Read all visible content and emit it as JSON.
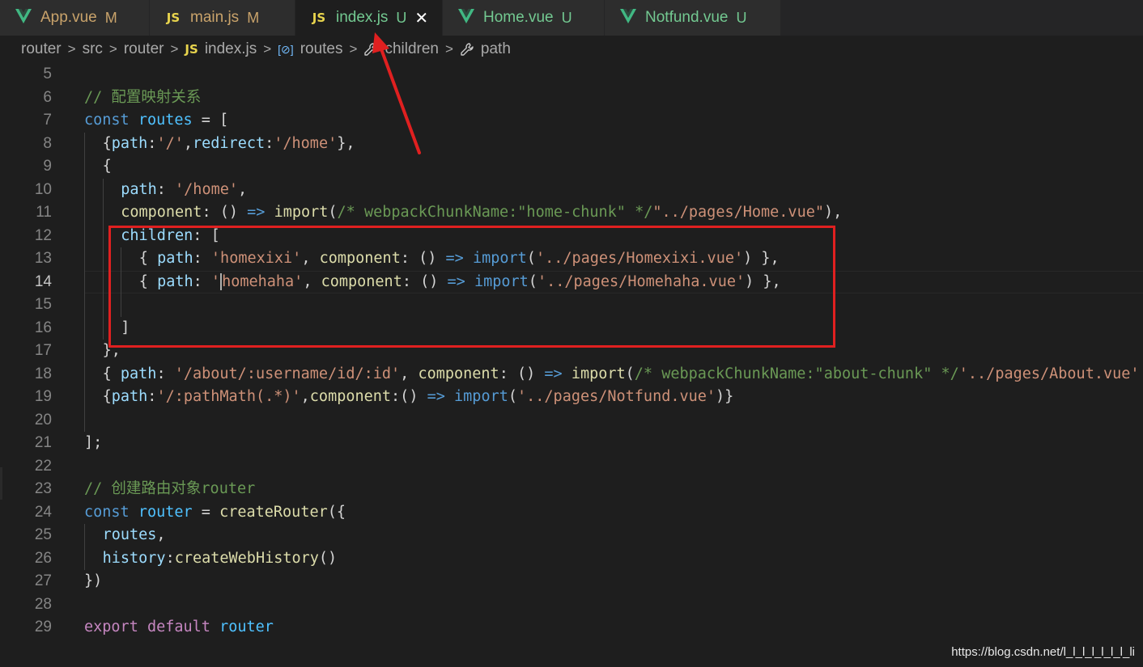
{
  "tabs": [
    {
      "icon": "vue-icon",
      "label": "App.vue",
      "status": "M",
      "status_type": "modified",
      "active": false
    },
    {
      "icon": "js-icon",
      "label": "main.js",
      "status": "M",
      "status_type": "modified",
      "active": false
    },
    {
      "icon": "js-icon",
      "label": "index.js",
      "status": "U",
      "status_type": "untracked",
      "active": true
    },
    {
      "icon": "vue-icon",
      "label": "Home.vue",
      "status": "U",
      "status_type": "untracked",
      "active": false
    },
    {
      "icon": "vue-icon",
      "label": "Notfund.vue",
      "status": "U",
      "status_type": "untracked",
      "active": false
    }
  ],
  "tab_icons": {
    "js": "JS",
    "close": "✕"
  },
  "breadcrumb": [
    {
      "label": "router",
      "icon": ""
    },
    {
      "label": "src",
      "icon": ""
    },
    {
      "label": "router",
      "icon": ""
    },
    {
      "label": "index.js",
      "icon": "js-icon"
    },
    {
      "label": "routes",
      "icon": "symbol-variable-icon"
    },
    {
      "label": "children",
      "icon": "wrench-icon"
    },
    {
      "label": "path",
      "icon": "wrench-icon"
    }
  ],
  "breadcrumb_symbol_glyph": "[⊘]",
  "editor": {
    "current_line": 14,
    "lines": [
      {
        "n": 5,
        "indent": 0,
        "tokens": []
      },
      {
        "n": 6,
        "indent": 0,
        "tokens": [
          [
            "cm",
            "// 配置映射关系"
          ]
        ]
      },
      {
        "n": 7,
        "indent": 0,
        "tokens": [
          [
            "kw",
            "const "
          ],
          [
            "var",
            "routes"
          ],
          [
            "pn",
            " = ["
          ]
        ]
      },
      {
        "n": 8,
        "indent": 1,
        "tokens": [
          [
            "pn",
            "{"
          ],
          [
            "prop",
            "path"
          ],
          [
            "pn",
            ":"
          ],
          [
            "str",
            "'/'"
          ],
          [
            "pn",
            ","
          ],
          [
            "prop",
            "redirect"
          ],
          [
            "pn",
            ":"
          ],
          [
            "str",
            "'/home'"
          ],
          [
            "pn",
            "},"
          ]
        ]
      },
      {
        "n": 9,
        "indent": 1,
        "tokens": [
          [
            "pn",
            "{"
          ]
        ]
      },
      {
        "n": 10,
        "indent": 2,
        "tokens": [
          [
            "prop",
            "path"
          ],
          [
            "pn",
            ": "
          ],
          [
            "str",
            "'/home'"
          ],
          [
            "pn",
            ","
          ]
        ]
      },
      {
        "n": 11,
        "indent": 2,
        "tokens": [
          [
            "fn",
            "component"
          ],
          [
            "pn",
            ": () "
          ],
          [
            "kw",
            "=>"
          ],
          [
            "pn",
            " "
          ],
          [
            "fn",
            "import"
          ],
          [
            "pn",
            "("
          ],
          [
            "cm",
            "/* webpackChunkName:\"home-chunk\" */"
          ],
          [
            "str",
            "\"../pages/Home.vue\""
          ],
          [
            "pn",
            "),"
          ]
        ]
      },
      {
        "n": 12,
        "indent": 2,
        "tokens": [
          [
            "prop",
            "children"
          ],
          [
            "pn",
            ": ["
          ]
        ]
      },
      {
        "n": 13,
        "indent": 3,
        "tokens": [
          [
            "pn",
            "{ "
          ],
          [
            "prop",
            "path"
          ],
          [
            "pn",
            ": "
          ],
          [
            "str",
            "'homexixi'"
          ],
          [
            "pn",
            ", "
          ],
          [
            "fn",
            "component"
          ],
          [
            "pn",
            ": () "
          ],
          [
            "kw",
            "=>"
          ],
          [
            "pn",
            " "
          ],
          [
            "kw",
            "import"
          ],
          [
            "pn",
            "("
          ],
          [
            "str",
            "'../pages/Homexixi.vue'"
          ],
          [
            "pn",
            ") },"
          ]
        ]
      },
      {
        "n": 14,
        "indent": 3,
        "tokens": [
          [
            "pn",
            "{ "
          ],
          [
            "prop",
            "path"
          ],
          [
            "pn",
            ": "
          ],
          [
            "str",
            "'"
          ],
          [
            "cursor",
            ""
          ],
          [
            "str",
            "homehaha'"
          ],
          [
            "pn",
            ", "
          ],
          [
            "fn",
            "component"
          ],
          [
            "pn",
            ": () "
          ],
          [
            "kw",
            "=>"
          ],
          [
            "pn",
            " "
          ],
          [
            "kw",
            "import"
          ],
          [
            "pn",
            "("
          ],
          [
            "str",
            "'../pages/Homehaha.vue'"
          ],
          [
            "pn",
            ") },"
          ]
        ]
      },
      {
        "n": 15,
        "indent": 3,
        "tokens": []
      },
      {
        "n": 16,
        "indent": 2,
        "tokens": [
          [
            "pn",
            "]"
          ]
        ]
      },
      {
        "n": 17,
        "indent": 1,
        "tokens": [
          [
            "pn",
            "},"
          ]
        ]
      },
      {
        "n": 18,
        "indent": 1,
        "tokens": [
          [
            "pn",
            "{ "
          ],
          [
            "prop",
            "path"
          ],
          [
            "pn",
            ": "
          ],
          [
            "str",
            "'/about/:username/id/:id'"
          ],
          [
            "pn",
            ", "
          ],
          [
            "fn",
            "component"
          ],
          [
            "pn",
            ": () "
          ],
          [
            "kw",
            "=>"
          ],
          [
            "pn",
            " "
          ],
          [
            "fn",
            "import"
          ],
          [
            "pn",
            "("
          ],
          [
            "cm",
            "/* webpackChunkName:\"about-chunk\" */"
          ],
          [
            "str",
            "'../pages/About.vue'"
          ]
        ]
      },
      {
        "n": 19,
        "indent": 1,
        "tokens": [
          [
            "pn",
            "{"
          ],
          [
            "prop",
            "path"
          ],
          [
            "pn",
            ":"
          ],
          [
            "str",
            "'/:pathMath(.*)'"
          ],
          [
            "pn",
            ","
          ],
          [
            "fn",
            "component"
          ],
          [
            "pn",
            ":() "
          ],
          [
            "kw",
            "=>"
          ],
          [
            "pn",
            " "
          ],
          [
            "kw",
            "import"
          ],
          [
            "pn",
            "("
          ],
          [
            "str",
            "'../pages/Notfund.vue'"
          ],
          [
            "pn",
            ")}"
          ]
        ]
      },
      {
        "n": 20,
        "indent": 1,
        "tokens": []
      },
      {
        "n": 21,
        "indent": 0,
        "tokens": [
          [
            "pn",
            "];"
          ]
        ]
      },
      {
        "n": 22,
        "indent": 0,
        "tokens": []
      },
      {
        "n": 23,
        "indent": 0,
        "tokens": [
          [
            "cm",
            "// 创建路由对象router"
          ]
        ]
      },
      {
        "n": 24,
        "indent": 0,
        "tokens": [
          [
            "kw",
            "const "
          ],
          [
            "var",
            "router"
          ],
          [
            "pn",
            " = "
          ],
          [
            "fn",
            "createRouter"
          ],
          [
            "pn",
            "({"
          ]
        ]
      },
      {
        "n": 25,
        "indent": 1,
        "tokens": [
          [
            "prop",
            "routes"
          ],
          [
            "pn",
            ","
          ]
        ]
      },
      {
        "n": 26,
        "indent": 1,
        "tokens": [
          [
            "prop",
            "history"
          ],
          [
            "pn",
            ":"
          ],
          [
            "fn",
            "createWebHistory"
          ],
          [
            "pn",
            "()"
          ]
        ]
      },
      {
        "n": 27,
        "indent": 0,
        "tokens": [
          [
            "pn",
            "})"
          ]
        ]
      },
      {
        "n": 28,
        "indent": 0,
        "tokens": []
      },
      {
        "n": 29,
        "indent": 0,
        "tokens": [
          [
            "kw2",
            "export default "
          ],
          [
            "var",
            "router"
          ]
        ]
      }
    ]
  },
  "colors": {
    "highlight_box": "#e02020",
    "arrow": "#e02020",
    "vue": "#41b883",
    "js": "#e8d44d"
  },
  "watermark": "https://blog.csdn.net/l_l_l_l_l_l_l_li"
}
